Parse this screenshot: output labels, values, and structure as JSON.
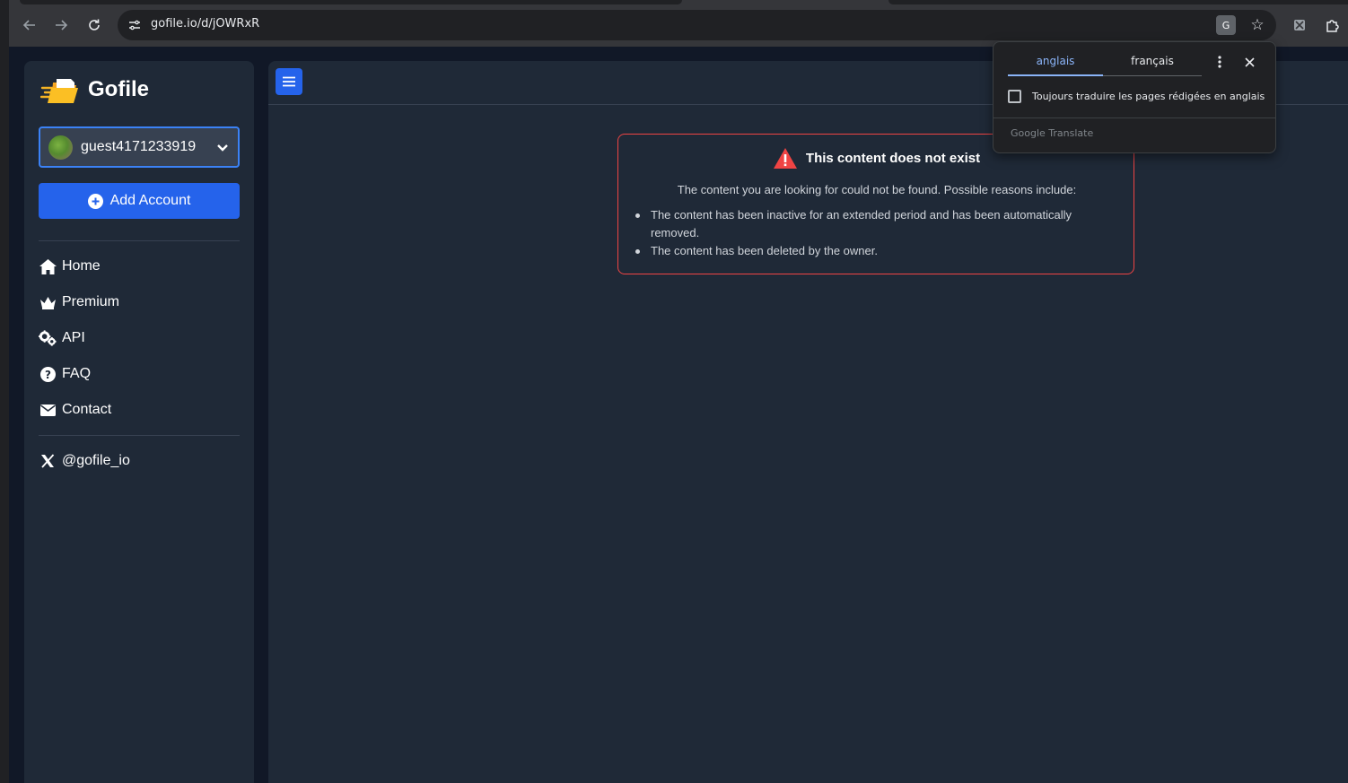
{
  "browser": {
    "url": "gofile.io/d/jOWRxR",
    "translate_icon_label": "G"
  },
  "sidebar": {
    "brand": "Gofile",
    "account": {
      "username": "guest4171233919"
    },
    "add_account_label": "Add Account",
    "nav": [
      {
        "label": "Home",
        "icon": "home-icon"
      },
      {
        "label": "Premium",
        "icon": "crown-icon"
      },
      {
        "label": "API",
        "icon": "gears-icon"
      },
      {
        "label": "FAQ",
        "icon": "question-circle-icon"
      },
      {
        "label": "Contact",
        "icon": "envelope-icon"
      }
    ],
    "social": {
      "label": "@gofile_io",
      "icon": "x-logo-icon"
    }
  },
  "main": {
    "alert": {
      "title": "This content does not exist",
      "description": "The content you are looking for could not be found. Possible reasons include:",
      "reasons": [
        "The content has been inactive for an extended period and has been automatically removed.",
        "The content has been deleted by the owner."
      ]
    }
  },
  "translate_popup": {
    "source_language": "anglais",
    "target_language": "français",
    "always_translate_label": "Toujours traduire les pages rédigées en anglais",
    "footer_brand": "Google",
    "footer_product": "Translate"
  },
  "colors": {
    "accent": "#2563eb",
    "panel": "#1f2937",
    "background": "#111827",
    "alert_border": "#ef4444",
    "popup_active_tab": "#8ab4f8"
  }
}
